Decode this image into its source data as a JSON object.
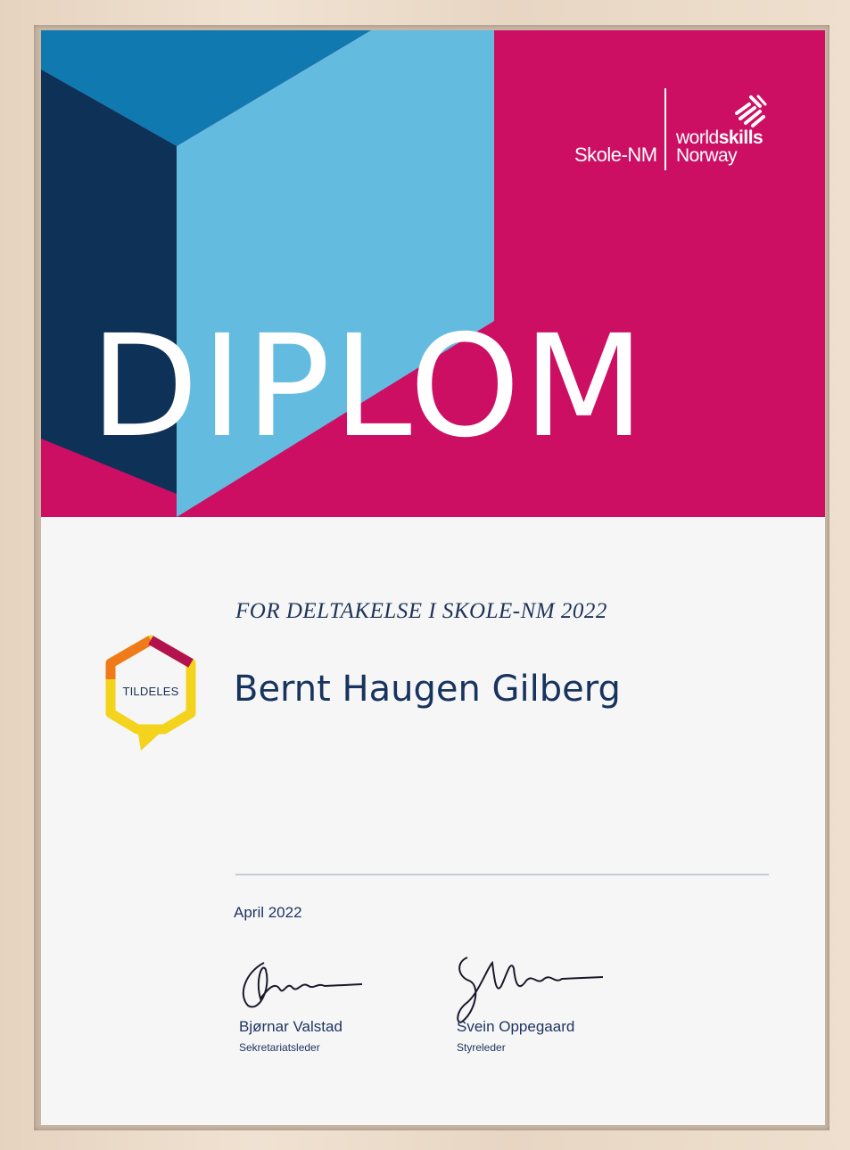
{
  "brand": {
    "left_label": "Skole-NM",
    "ws_light": "world",
    "ws_bold": "skills",
    "ws_country": "Norway"
  },
  "title": "DIPLOM",
  "subtitle": "FOR DELTAKELSE I SKOLE-NM 2022",
  "badge_label": "TILDELES",
  "recipient": "Bernt Haugen Gilberg",
  "date": "April 2022",
  "signatories": [
    {
      "name": "Bjørnar Valstad",
      "role": "Sekretariatsleder"
    },
    {
      "name": "Svein Oppegaard",
      "role": "Styreleder"
    }
  ],
  "colors": {
    "magenta": "#cd0f64",
    "navy": "#0e3157",
    "mid_blue": "#1079b0",
    "light_blue": "#63bbe0",
    "text_navy": "#17335e",
    "badge_orange": "#f07a1a",
    "badge_yellow": "#f3d31c",
    "badge_purple": "#b3124f"
  }
}
